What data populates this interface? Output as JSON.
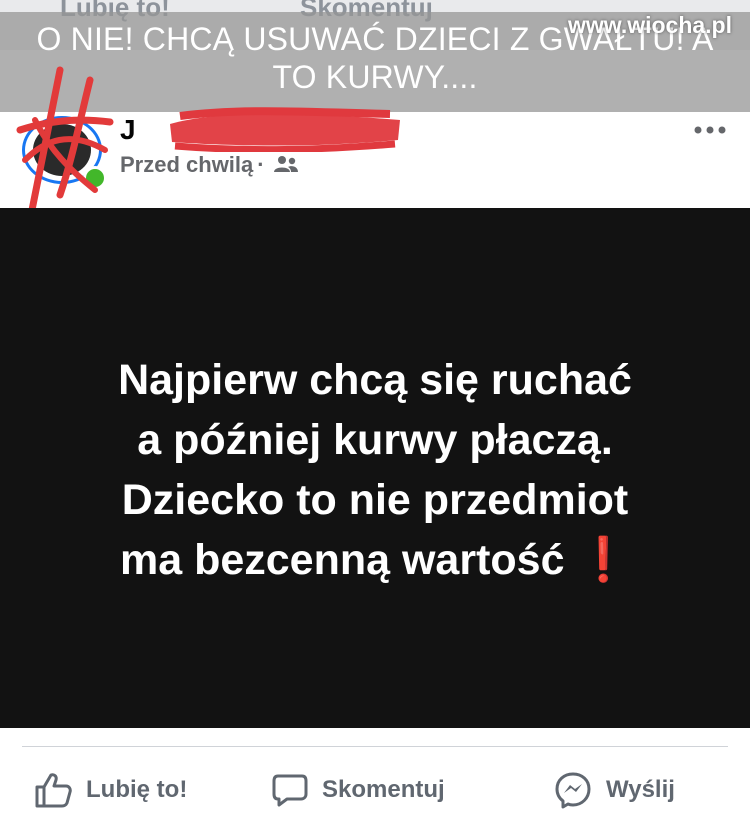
{
  "ghost_actions": {
    "like": "Lubię to!",
    "comment": "Skomentuj"
  },
  "caption": {
    "line1": "O NIE! CHCĄ USUWAĆ DZIECI Z GWAŁTU! A",
    "line2": "TO KURWY...."
  },
  "watermark": "www.wiocha.pl",
  "post": {
    "author_visible": "J",
    "time": "Przed chwilą",
    "separator": "·",
    "audience_icon": "friends-icon",
    "more_icon": "more-horizontal-icon",
    "text_lines": [
      "Najpierw chcą się ruchać",
      "a później kurwy płaczą.",
      "Dziecko to nie przedmiot",
      "ma bezcenną wartość"
    ],
    "emoji": "❗"
  },
  "actions": {
    "like": "Lubię to!",
    "comment": "Skomentuj",
    "send": "Wyślij"
  },
  "colors": {
    "post_background": "#121212",
    "avatar_ring": "#1877f2",
    "online": "#42b72a",
    "scribble": "#e23a3a"
  }
}
